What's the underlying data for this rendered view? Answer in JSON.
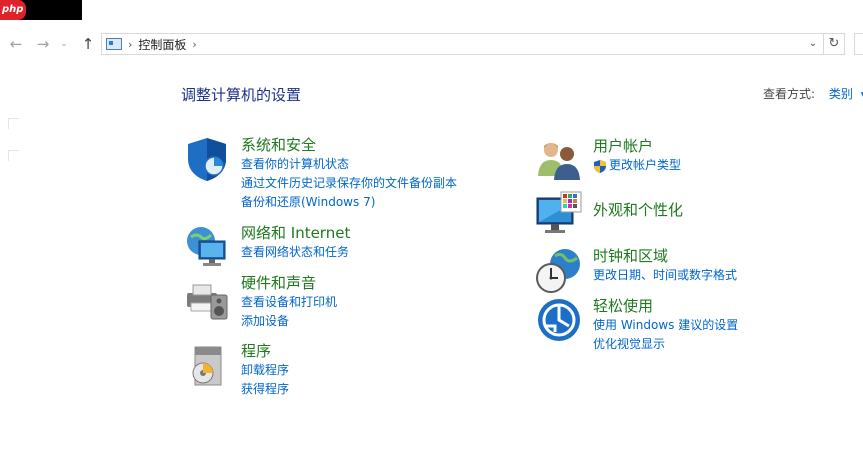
{
  "watermark": {
    "label": "php"
  },
  "nav": {
    "back_icon": "arrow-left-icon",
    "forward_icon": "arrow-right-icon",
    "recent_icon": "chevron-down-icon",
    "up_icon": "arrow-up-icon"
  },
  "address": {
    "separator": "›",
    "path": "控制面板",
    "trailing_separator": "›",
    "dropdown": "⌄",
    "refresh": "↻"
  },
  "page": {
    "title": "调整计算机的设置",
    "view_by_label": "查看方式:",
    "view_by_value": "类别"
  },
  "left_categories": [
    {
      "title": "系统和安全",
      "icon": "shield-icon",
      "links": [
        "查看你的计算机状态",
        "通过文件历史记录保存你的文件备份副本",
        "备份和还原(Windows 7)"
      ]
    },
    {
      "title": "网络和 Internet",
      "icon": "network-globe-icon",
      "links": [
        "查看网络状态和任务"
      ]
    },
    {
      "title": "硬件和声音",
      "icon": "printer-speaker-icon",
      "links": [
        "查看设备和打印机",
        "添加设备"
      ]
    },
    {
      "title": "程序",
      "icon": "programs-disc-icon",
      "links": [
        "卸载程序",
        "获得程序"
      ]
    }
  ],
  "right_categories": [
    {
      "title": "用户帐户",
      "icon": "users-icon",
      "links": [
        "更改帐户类型"
      ]
    },
    {
      "title": "外观和个性化",
      "icon": "monitor-palette-icon",
      "links": []
    },
    {
      "title": "时钟和区域",
      "icon": "clock-globe-icon",
      "links": [
        "更改日期、时间或数字格式"
      ]
    },
    {
      "title": "轻松使用",
      "icon": "ease-of-access-icon",
      "links": [
        "使用 Windows 建议的设置",
        "优化视觉显示"
      ]
    }
  ],
  "colors": {
    "category_title": "#1d7a1d",
    "link": "#0066cc",
    "page_title": "#1e3287"
  }
}
